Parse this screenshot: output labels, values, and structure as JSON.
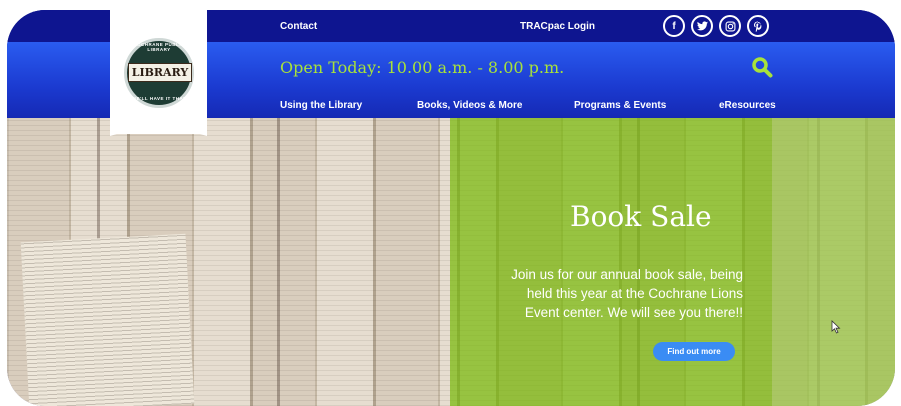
{
  "header": {
    "contact_label": "Contact",
    "tracpac_label": "TRACpac Login",
    "social": [
      "f",
      "t",
      "o",
      "p"
    ],
    "social_icons": [
      "facebook-icon",
      "twitter-icon",
      "instagram-icon",
      "pinterest-icon"
    ],
    "hours": "Open Today: 10.00 a.m. - 8.00 p.m.",
    "nav": [
      "Using the Library",
      "Books, Videos & More",
      "Programs & Events",
      "eResources"
    ]
  },
  "logo": {
    "word": "LIBRARY",
    "arc_top": "COCHRANE PUBLIC LIBRARY",
    "arc_bottom": "WE'LL HAVE IT THAT"
  },
  "hero": {
    "title": "Book Sale",
    "body": "Join us for our annual book sale, being held this year at the Cochrane Lions Event center. We will see you there!!",
    "button_label": "Find out more"
  },
  "colors": {
    "top_bar": "#0e1590",
    "header_blue": "#2a5cf0",
    "accent_green": "#a8e23a",
    "overlay_green": "#78b90a",
    "button_blue": "#3a8cf4"
  }
}
